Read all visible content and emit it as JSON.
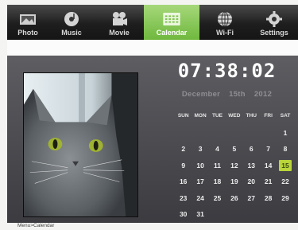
{
  "nav": {
    "tabs": [
      {
        "label": "Photo",
        "icon": "photo-icon"
      },
      {
        "label": "Music",
        "icon": "music-icon"
      },
      {
        "label": "Movie",
        "icon": "movie-icon"
      },
      {
        "label": "Calendar",
        "icon": "calendar-icon",
        "active": true
      },
      {
        "label": "Wi-Fi",
        "icon": "globe-icon"
      },
      {
        "label": "Settings",
        "icon": "gear-icon"
      }
    ],
    "active_color": "#7cc045"
  },
  "clock": {
    "time": "07:38:02"
  },
  "date": {
    "month": "December",
    "day": "15th",
    "year": "2012"
  },
  "calendar": {
    "weekdays": [
      "SUN",
      "MON",
      "TUE",
      "WED",
      "THU",
      "FRI",
      "SAT"
    ],
    "rows": [
      [
        "",
        "",
        "",
        "",
        "",
        "",
        "1"
      ],
      [
        "2",
        "3",
        "4",
        "5",
        "6",
        "7",
        "8"
      ],
      [
        "9",
        "10",
        "11",
        "12",
        "13",
        "14",
        "15"
      ],
      [
        "16",
        "17",
        "18",
        "19",
        "20",
        "21",
        "22"
      ],
      [
        "23",
        "24",
        "25",
        "26",
        "27",
        "28",
        "29"
      ],
      [
        "30",
        "31",
        "",
        "",
        "",
        "",
        ""
      ]
    ],
    "today": "15",
    "today_color": "#b9d53a"
  },
  "status": {
    "path": "Menu>Calendar"
  }
}
